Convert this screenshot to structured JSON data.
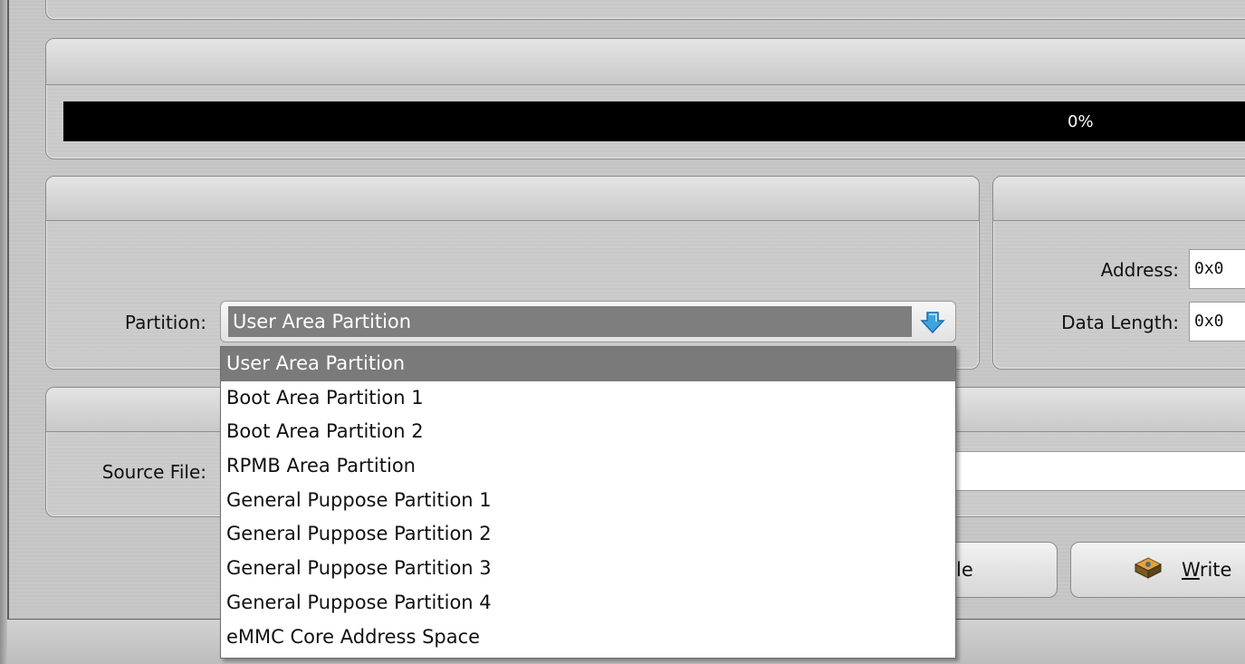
{
  "progress": {
    "percent_text": "0%",
    "value": 0
  },
  "partition": {
    "label": "Partition:",
    "selected": "User Area Partition",
    "options": [
      "User Area Partition",
      "Boot Area Partition 1",
      "Boot Area Partition 2",
      "RPMB Area Partition",
      "General Puppose Partition 1",
      "General Puppose Partition 2",
      "General Puppose Partition 3",
      "General Puppose Partition 4",
      "eMMC Core Address Space"
    ]
  },
  "address": {
    "label": "Address:",
    "value": "0x0"
  },
  "data_length": {
    "label": "Data Length:",
    "value": "0x0"
  },
  "source_file": {
    "label": "Source File:",
    "value": ""
  },
  "buttons": {
    "partial_label": "le",
    "write_label_first": "W",
    "write_label_rest": "rite"
  },
  "colors": {
    "selection": "#7a7a7a",
    "progress_bg": "#000000"
  }
}
